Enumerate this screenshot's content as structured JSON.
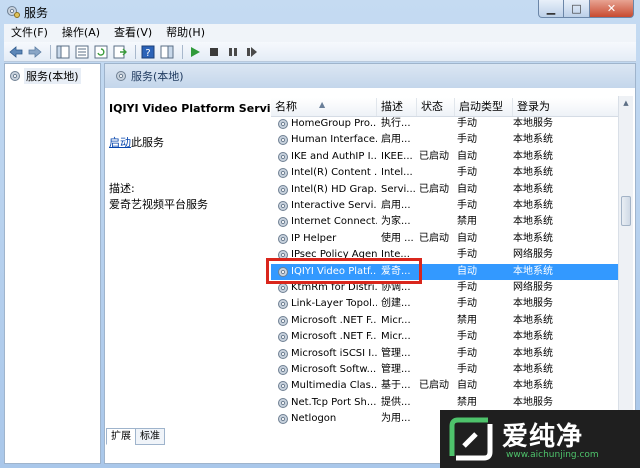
{
  "window": {
    "title": "服务"
  },
  "menu": [
    "文件(F)",
    "操作(A)",
    "查看(V)",
    "帮助(H)"
  ],
  "left_pane": {
    "tree_item": "服务(本地)"
  },
  "pane_header": {
    "title": "服务(本地)"
  },
  "desc_panel": {
    "service_name": "IQIYI Video Platform Service",
    "start_link": "启动",
    "start_suffix": "此服务",
    "desc_label": "描述:",
    "desc_text": "爱奇艺视频平台服务"
  },
  "list": {
    "columns": [
      "名称",
      "描述",
      "状态",
      "启动类型",
      "登录为"
    ],
    "rows": [
      {
        "name": "HomeGroup Pro...",
        "desc": "执行...",
        "status": "",
        "start": "手动",
        "logon": "本地服务"
      },
      {
        "name": "Human Interface...",
        "desc": "启用...",
        "status": "",
        "start": "手动",
        "logon": "本地系统"
      },
      {
        "name": "IKE and AuthIP I...",
        "desc": "IKEE...",
        "status": "已启动",
        "start": "自动",
        "logon": "本地系统"
      },
      {
        "name": "Intel(R) Content ...",
        "desc": "Intel...",
        "status": "",
        "start": "手动",
        "logon": "本地系统"
      },
      {
        "name": "Intel(R) HD Grap...",
        "desc": "Servi...",
        "status": "已启动",
        "start": "自动",
        "logon": "本地系统"
      },
      {
        "name": "Interactive Servi...",
        "desc": "启用...",
        "status": "",
        "start": "手动",
        "logon": "本地系统"
      },
      {
        "name": "Internet Connect...",
        "desc": "为家...",
        "status": "",
        "start": "禁用",
        "logon": "本地系统"
      },
      {
        "name": "IP Helper",
        "desc": "使用 ...",
        "status": "已启动",
        "start": "自动",
        "logon": "本地系统"
      },
      {
        "name": "IPsec Policy Agent",
        "desc": "Inte...",
        "status": "",
        "start": "手动",
        "logon": "网络服务"
      },
      {
        "name": "IQIYI Video Platf...",
        "desc": "爱奇...",
        "status": "",
        "start": "自动",
        "logon": "本地系统"
      },
      {
        "name": "KtmRm for Distri...",
        "desc": "协调...",
        "status": "",
        "start": "手动",
        "logon": "网络服务"
      },
      {
        "name": "Link-Layer Topol...",
        "desc": "创建...",
        "status": "",
        "start": "手动",
        "logon": "本地服务"
      },
      {
        "name": "Microsoft .NET F...",
        "desc": "Micr...",
        "status": "",
        "start": "禁用",
        "logon": "本地系统"
      },
      {
        "name": "Microsoft .NET F...",
        "desc": "Micr...",
        "status": "",
        "start": "手动",
        "logon": "本地系统"
      },
      {
        "name": "Microsoft iSCSI I...",
        "desc": "管理...",
        "status": "",
        "start": "手动",
        "logon": "本地系统"
      },
      {
        "name": "Microsoft Softw...",
        "desc": "管理...",
        "status": "",
        "start": "手动",
        "logon": "本地系统"
      },
      {
        "name": "Multimedia Clas...",
        "desc": "基于...",
        "status": "已启动",
        "start": "自动",
        "logon": "本地系统"
      },
      {
        "name": "Net.Tcp Port Sh...",
        "desc": "提供...",
        "status": "",
        "start": "禁用",
        "logon": "本地服务"
      },
      {
        "name": "Netlogon",
        "desc": "为用...",
        "status": "",
        "start": "手动",
        "logon": "本地系统"
      }
    ],
    "selected_index": 9
  },
  "tabs": [
    "扩展",
    "标准"
  ],
  "watermark": {
    "text": "爱纯净",
    "url": "www.aichunjing.com"
  },
  "colors": {
    "selection": "#3399ff",
    "highlight_box": "#d9261c"
  }
}
